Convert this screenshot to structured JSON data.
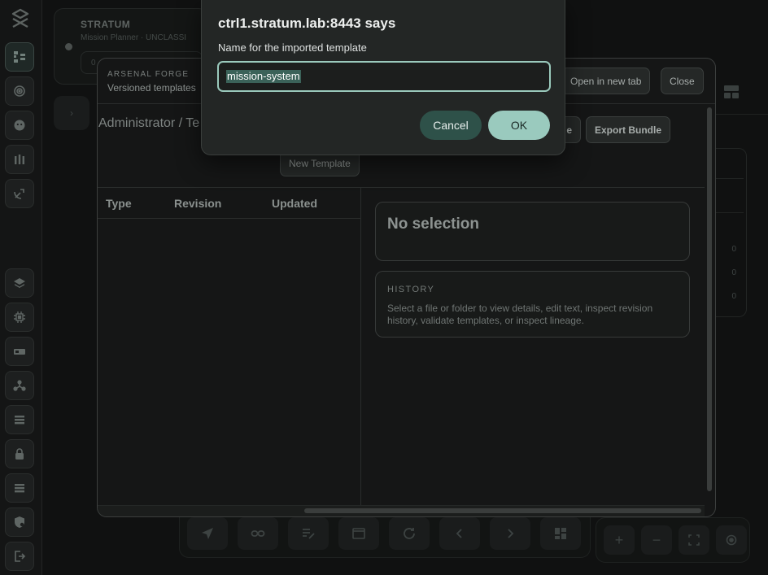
{
  "background_app": {
    "title": "STRATUM",
    "subtitle": "Mission Planner · UNCLASSI",
    "pill_label": "0",
    "right_panel_counts": [
      "0",
      "0",
      "0"
    ]
  },
  "forge": {
    "eyebrow": "ARSENAL FORGE",
    "subtitle": "Versioned templates",
    "open_new_tab_label": "Open in new tab",
    "close_label": "Close",
    "partial_button_label": "e",
    "export_bundle_label": "Export Bundle",
    "new_template_label": "New Template",
    "breadcrumb": "Administrator / Te",
    "columns": [
      "Type",
      "Revision",
      "Updated"
    ],
    "selection_title": "No selection",
    "history_eyebrow": "HISTORY",
    "history_text": "Select a file or folder to view details, edit text, inspect revision history, validate templates, or inspect lineage."
  },
  "prompt": {
    "title": "ctrl1.stratum.lab:8443 says",
    "message": "Name for the imported template",
    "input_value": "mission-system",
    "cancel_label": "Cancel",
    "ok_label": "OK"
  },
  "colors": {
    "accent": "#9acabe",
    "accent_dark": "#2e5149",
    "background": "#101111"
  }
}
